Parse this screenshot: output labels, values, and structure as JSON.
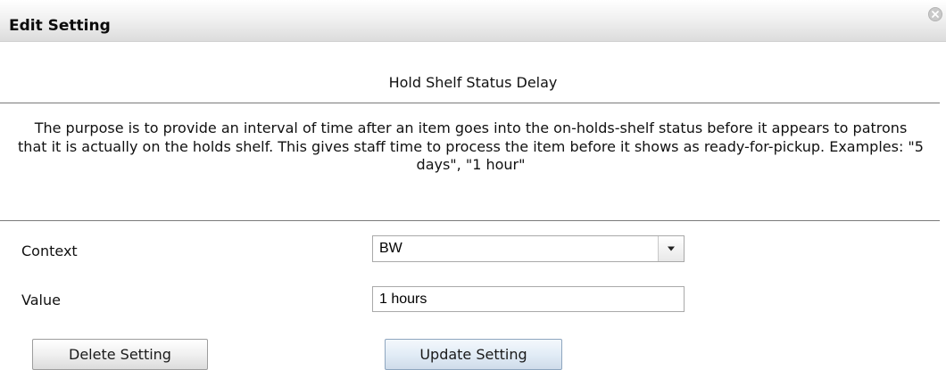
{
  "dialog": {
    "title": "Edit Setting",
    "close_icon": "close-icon"
  },
  "setting": {
    "name": "Hold Shelf Status Delay",
    "description": "The purpose is to provide an interval of time after an item goes into the on-holds-shelf status before it appears to patrons that it is actually on the holds shelf. This gives staff time to process the item before it shows as ready-for-pickup. Examples: \"5 days\", \"1 hour\""
  },
  "form": {
    "context_label": "Context",
    "context_value": "BW",
    "value_label": "Value",
    "value_input": "1 hours"
  },
  "buttons": {
    "delete_label": "Delete Setting",
    "update_label": "Update Setting"
  },
  "colors": {
    "update_button": "#e2ecf6",
    "title_text": "#0b0b0b"
  }
}
